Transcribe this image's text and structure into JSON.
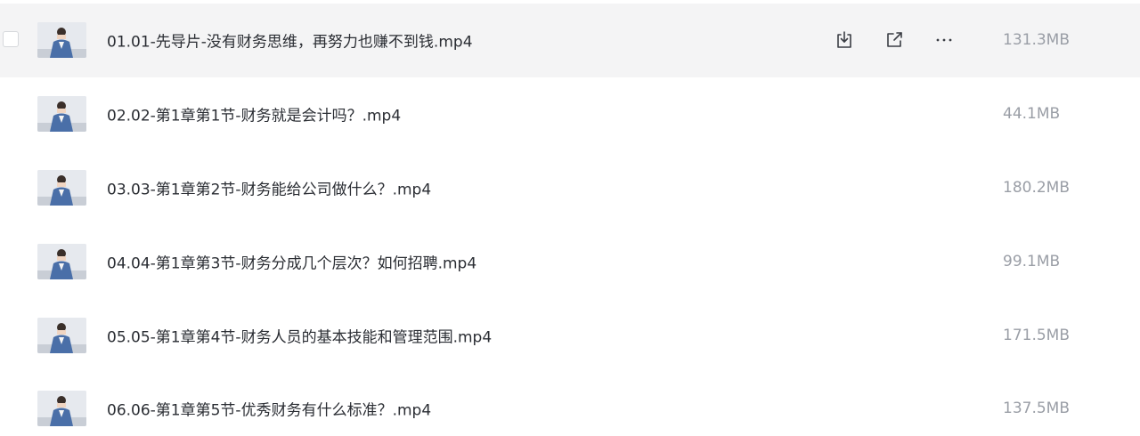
{
  "files": [
    {
      "name": "01.01-先导片-没有财务思维，再努力也赚不到钱.mp4",
      "size": "131.3MB",
      "hovered": true
    },
    {
      "name": "02.02-第1章第1节-财务就是会计吗？.mp4",
      "size": "44.1MB"
    },
    {
      "name": "03.03-第1章第2节-财务能给公司做什么？.mp4",
      "size": "180.2MB"
    },
    {
      "name": "04.04-第1章第3节-财务分成几个层次？如何招聘.mp4",
      "size": "99.1MB"
    },
    {
      "name": "05.05-第1章第4节-财务人员的基本技能和管理范围.mp4",
      "size": "171.5MB"
    },
    {
      "name": "06.06-第1章第5节-优秀财务有什么标准？.mp4",
      "size": "137.5MB"
    }
  ],
  "row_actions": [
    {
      "icon": "download-icon"
    },
    {
      "icon": "share-icon"
    },
    {
      "icon": "more-icon"
    }
  ],
  "colors": {
    "hover_row_bg": "#f4f4f5",
    "name_text": "#2a2d33",
    "size_text": "#9a9ea6",
    "icon_stroke": "#3a3d44"
  }
}
